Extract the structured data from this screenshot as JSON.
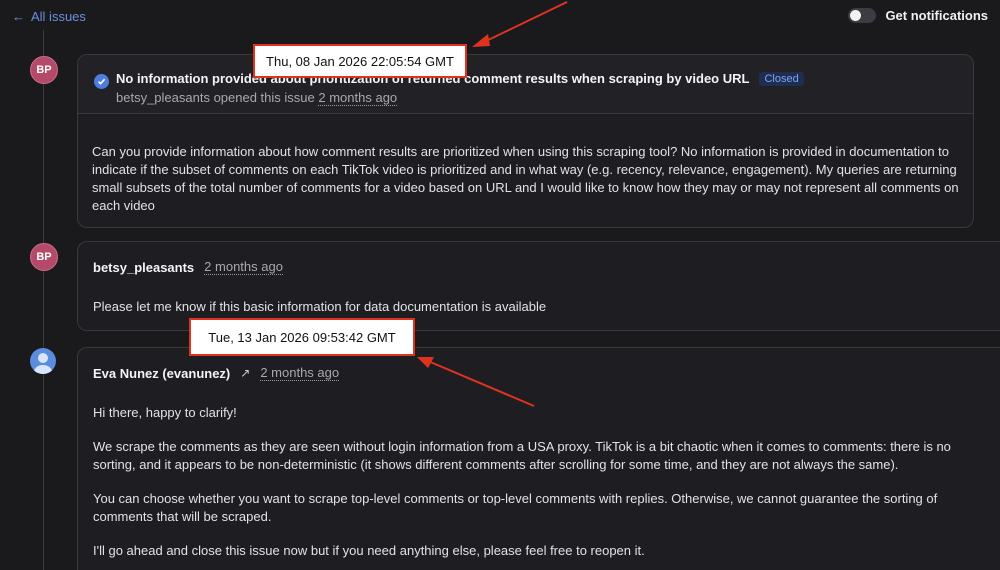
{
  "nav": {
    "back_arrow": "←",
    "back_label": "All issues",
    "notifications_label": "Get notifications",
    "notifications_on": false
  },
  "issue": {
    "author_initials": "BP",
    "title": "No information provided about prioritization of returned comment results when scraping by video URL",
    "status": "Closed",
    "meta_prefix": "betsy_pleasants opened this issue",
    "meta_time": "2 months ago",
    "body": "Can you provide information about how comment results are prioritized when using this scraping tool? No information is provided in documentation to indicate if the subset of comments on each TikTok video is prioritized and in what way (e.g. recency, relevance, engagement). My queries are returning small subsets of the total number of comments for a video based on URL and I would like to know how they may or may not represent all comments on each video"
  },
  "comments": [
    {
      "author_initials": "BP",
      "author": "betsy_pleasants",
      "time": "2 months ago",
      "paragraphs": [
        "Please let me know if this basic information for data documentation is available"
      ]
    },
    {
      "author": "Eva Nunez (evanunez)",
      "external_icon": "↗",
      "time": "2 months ago",
      "paragraphs": [
        "Hi there, happy to clarify!",
        "We scrape the comments as they are seen without login information from a USA proxy. TikTok is a bit chaotic when it comes to comments: there is no sorting, and it appears to be non-deterministic (it shows different comments after scrolling for some time, and they are not always the same).",
        "You can choose whether you want to scrape top-level comments or top-level comments with replies. Otherwise, we cannot guarantee the sorting of comments that will be scraped.",
        "I'll go ahead and close this issue now but if you need anything else, please feel free to reopen it."
      ]
    }
  ],
  "annotations": {
    "callout1": "Thu, 08 Jan 2026 22:05:54 GMT",
    "callout2": "Tue, 13 Jan 2026 09:53:42 GMT",
    "color": "#e0331f"
  }
}
